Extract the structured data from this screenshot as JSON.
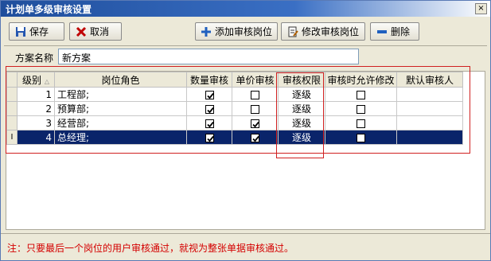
{
  "window": {
    "title": "计划单多级审核设置",
    "close_label": "×"
  },
  "toolbar": {
    "save_label": "保存",
    "cancel_label": "取消",
    "add_label": "添加审核岗位",
    "edit_label": "修改审核岗位",
    "delete_label": "删除"
  },
  "plan": {
    "label": "方案名称",
    "value": "新方案"
  },
  "grid": {
    "columns": [
      "级别",
      "岗位角色",
      "数量审核",
      "单价审核",
      "审核权限",
      "审核时允许修改",
      "默认审核人"
    ],
    "rows": [
      {
        "level": "1",
        "role": "工程部;",
        "qty": true,
        "price": false,
        "perm": "逐级",
        "allow_edit": false,
        "default_user": "",
        "indicator": ""
      },
      {
        "level": "2",
        "role": "预算部;",
        "qty": true,
        "price": false,
        "perm": "逐级",
        "allow_edit": false,
        "default_user": "",
        "indicator": ""
      },
      {
        "level": "3",
        "role": "经营部;",
        "qty": true,
        "price": true,
        "perm": "逐级",
        "allow_edit": false,
        "default_user": "",
        "indicator": ""
      },
      {
        "level": "4",
        "role": "总经理;",
        "qty": true,
        "price": true,
        "perm": "逐级",
        "allow_edit": false,
        "default_user": "",
        "indicator": "I"
      }
    ],
    "selected_row": 4
  },
  "note": "注：只要最后一个岗位的用户审核通过，就视为整张单据审核通过。",
  "colors": {
    "title_bar": "#1f4e9c",
    "selection": "#0a246a",
    "note": "#d40000",
    "highlight_box": "#d02020"
  }
}
